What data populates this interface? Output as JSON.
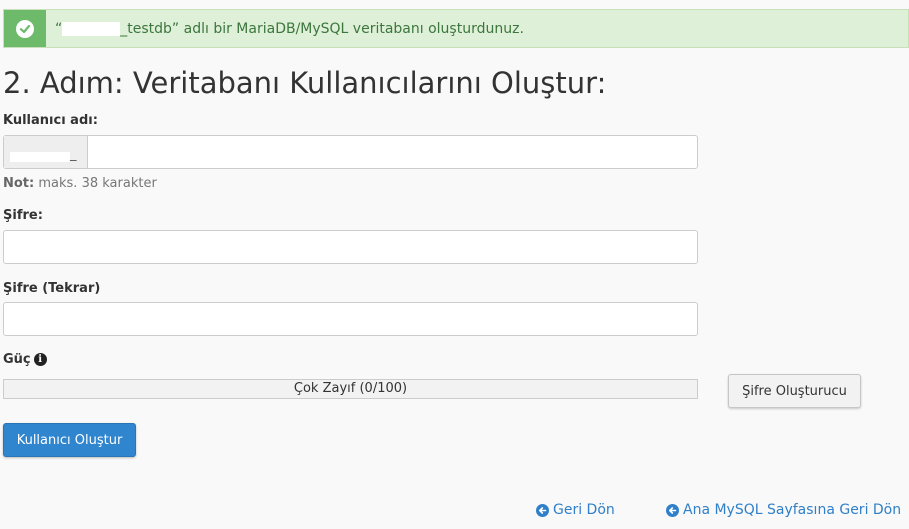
{
  "alert": {
    "text_prefix": "“",
    "text_suffix": "_testdb” adlı bir MariaDB/MySQL veritabanı oluşturdunuz.",
    "icon": "check-circle-icon",
    "color": "#3c763d",
    "background": "#dff0d8"
  },
  "page": {
    "title": "2. Adım: Veritabanı Kullanıcılarını Oluştur:"
  },
  "form": {
    "username_label": "Kullanıcı adı:",
    "username_prefix": "_",
    "username_value": "",
    "note_bold": "Not:",
    "note_text": " maks. 38 karakter",
    "password_label": "Şifre:",
    "password_value": "",
    "password_repeat_label": "Şifre (Tekrar)",
    "password_repeat_value": "",
    "strength_label": "Güç",
    "strength_text": "Çok Zayıf (0/100)",
    "strength_value": 0,
    "generator_button": "Şifre Oluşturucu",
    "create_button": "Kullanıcı Oluştur"
  },
  "links": {
    "back": "Geri Dön",
    "back_to_mysql": "Ana MySQL Sayfasına Geri Dön"
  },
  "colors": {
    "primary": "#2f86cf",
    "link": "#2f80c9",
    "success": "#6dbb6a"
  }
}
